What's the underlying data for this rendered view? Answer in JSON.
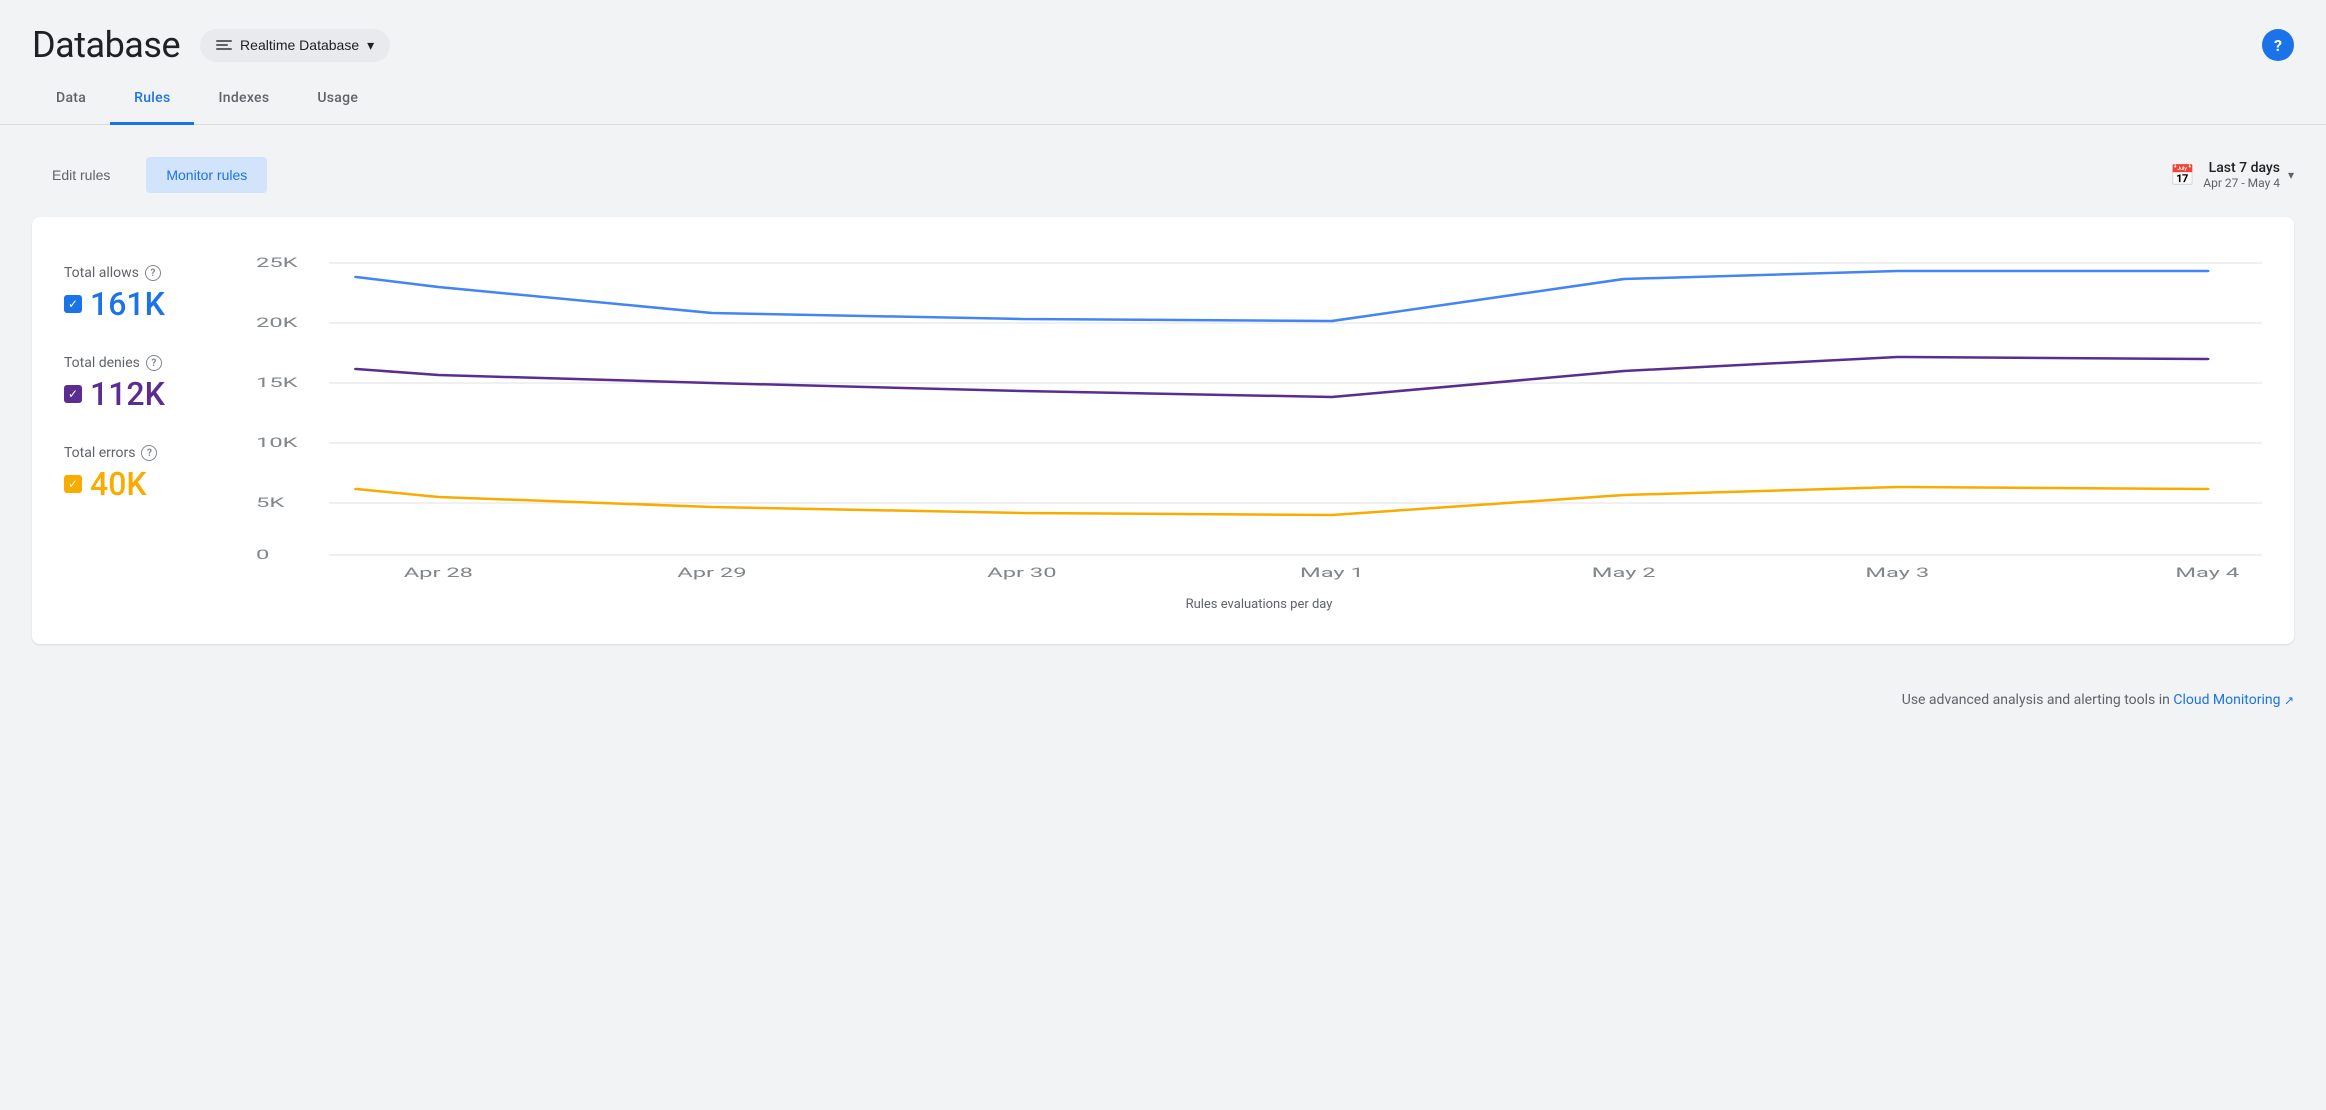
{
  "header": {
    "title": "Database",
    "db_selector_label": "Realtime Database",
    "help_icon": "?"
  },
  "nav": {
    "tabs": [
      {
        "label": "Data",
        "active": false
      },
      {
        "label": "Rules",
        "active": true
      },
      {
        "label": "Indexes",
        "active": false
      },
      {
        "label": "Usage",
        "active": false
      }
    ]
  },
  "toolbar": {
    "edit_rules_label": "Edit rules",
    "monitor_rules_label": "Monitor rules",
    "date_range_label": "Last 7 days",
    "date_range_sub": "Apr 27 - May 4"
  },
  "chart": {
    "title": "Rules evaluations per day",
    "total_allows_label": "Total allows",
    "total_allows_value": "161K",
    "total_denies_label": "Total denies",
    "total_denies_value": "112K",
    "total_errors_label": "Total errors",
    "total_errors_value": "40K",
    "y_axis": [
      "25K",
      "20K",
      "15K",
      "10K",
      "5K",
      "0"
    ],
    "x_axis": [
      "Apr 28",
      "Apr 29",
      "Apr 30",
      "May 1",
      "May 2",
      "May 3",
      "May 4"
    ]
  },
  "footer": {
    "note": "Use advanced analysis and alerting tools in",
    "link_label": "Cloud Monitoring"
  },
  "colors": {
    "allows": "#4285f4",
    "denies": "#5c2d91",
    "errors": "#f9ab00",
    "active_tab": "#1a73e8"
  }
}
